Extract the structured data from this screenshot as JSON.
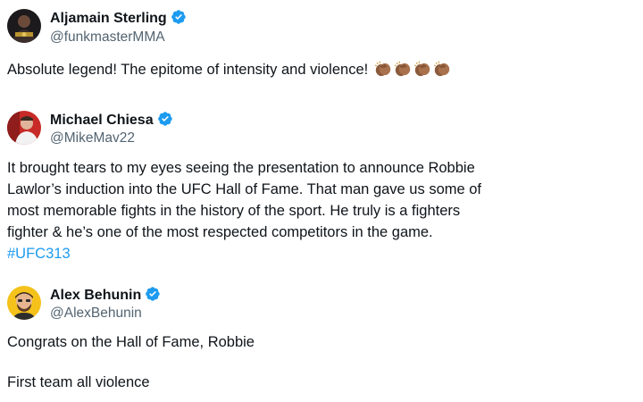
{
  "tweets": [
    {
      "name": "Aljamain Sterling",
      "handle": "@funkmasterMMA",
      "verified": true,
      "text": "Absolute legend! The epitome of intensity and violence!",
      "emoji": [
        "clapping-hands",
        "clapping-hands",
        "clapping-hands",
        "clapping-hands"
      ]
    },
    {
      "name": "Michael Chiesa",
      "handle": "@MikeMav22",
      "verified": true,
      "lines": [
        "It brought tears to my eyes seeing the presentation to announce Robbie",
        "Lawlor’s induction into the UFC Hall of Fame. That man gave us some of",
        "most memorable fights in the history of the sport. He truly is a fighters",
        "fighter & he’s one of the most respected competitors in the game."
      ],
      "hashtag": "#UFC313"
    },
    {
      "name": "Alex Behunin",
      "handle": "@AlexBehunin",
      "verified": true,
      "line1": "Congrats on the Hall of Fame, Robbie",
      "line2": "First team all violence"
    }
  ],
  "colors": {
    "text": "#0f1419",
    "secondary": "#536471",
    "accent": "#1d9bf0",
    "verified": "#1d9bf0"
  }
}
